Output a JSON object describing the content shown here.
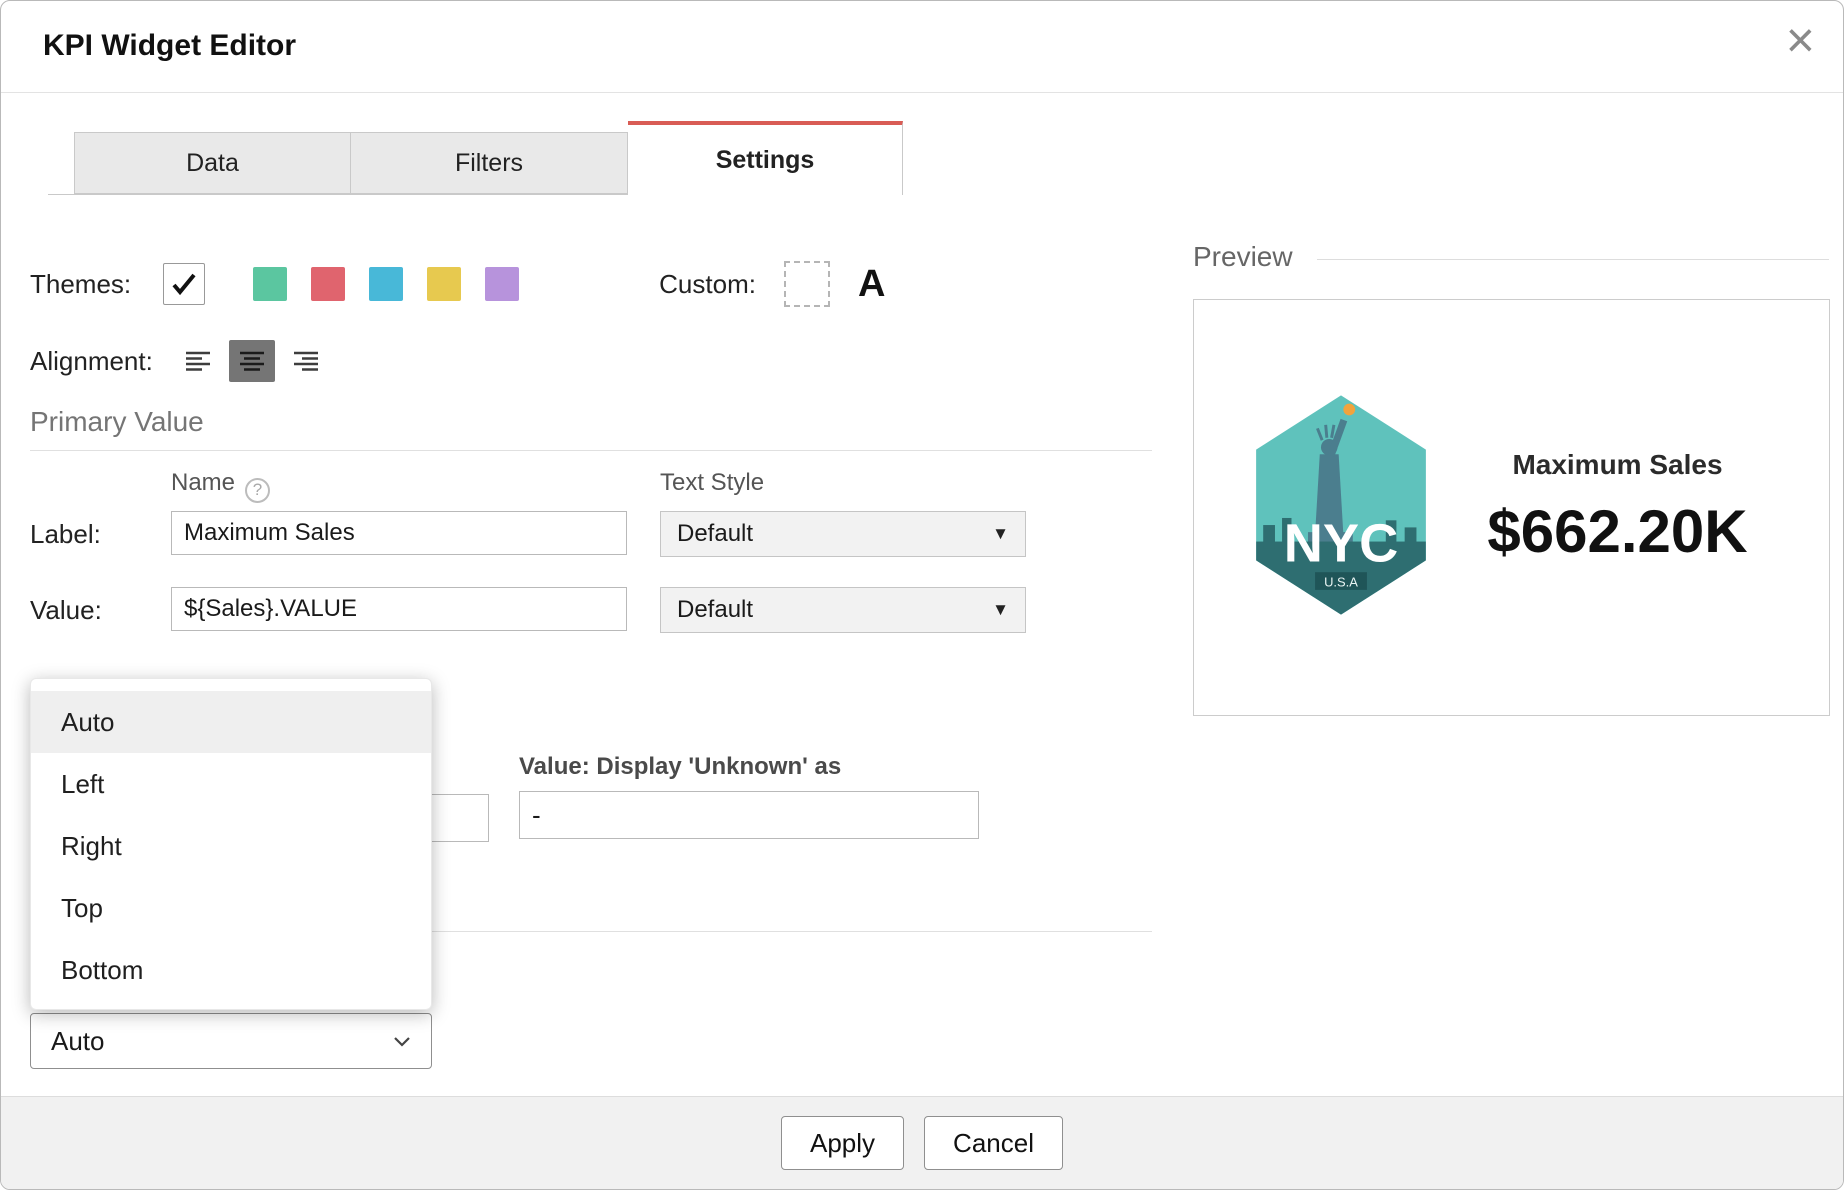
{
  "dialog": {
    "title": "KPI Widget Editor"
  },
  "icons": {
    "close": "×",
    "dropdown_arrow": "▼",
    "help": "?"
  },
  "tabs": [
    {
      "label": "Data"
    },
    {
      "label": "Filters"
    },
    {
      "label": "Settings"
    }
  ],
  "settings": {
    "themes_label": "Themes:",
    "theme_colors": [
      "#5bc6a0",
      "#e0646e",
      "#48b8d8",
      "#e7c94f",
      "#b793dc"
    ],
    "custom_label": "Custom:",
    "custom_letter": "A",
    "alignment_label": "Alignment:",
    "primary_value_heading": "Primary Value",
    "name_label": "Name",
    "text_style_label": "Text Style",
    "label_field_label": "Label:",
    "label_value": "Maximum Sales",
    "label_text_style_value": "Default",
    "value_field_label": "Value:",
    "value_value": "${Sales}.VALUE",
    "value_text_style_value": "Default",
    "unknown_label": "Value: Display 'Unknown' as",
    "unknown_value": "-",
    "hidden_input_value": "",
    "position_select_value": "Auto",
    "dropdown_options": [
      "Auto",
      "Left",
      "Right",
      "Top",
      "Bottom"
    ]
  },
  "preview": {
    "heading": "Preview",
    "kpi_label": "Maximum Sales",
    "kpi_value": "$662.20K",
    "badge_city": "NYC",
    "badge_country": "U.S.A"
  },
  "footer": {
    "apply_label": "Apply",
    "cancel_label": "Cancel"
  }
}
